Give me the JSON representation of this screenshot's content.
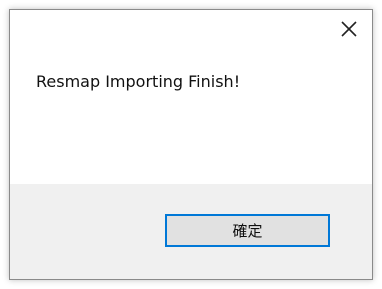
{
  "dialog": {
    "message": "Resmap Importing Finish!",
    "ok_label": "確定",
    "close_icon": "close-icon"
  },
  "colors": {
    "footer_bg": "#f0f0f0",
    "button_border": "#0078d7",
    "button_bg": "#e1e1e1"
  }
}
